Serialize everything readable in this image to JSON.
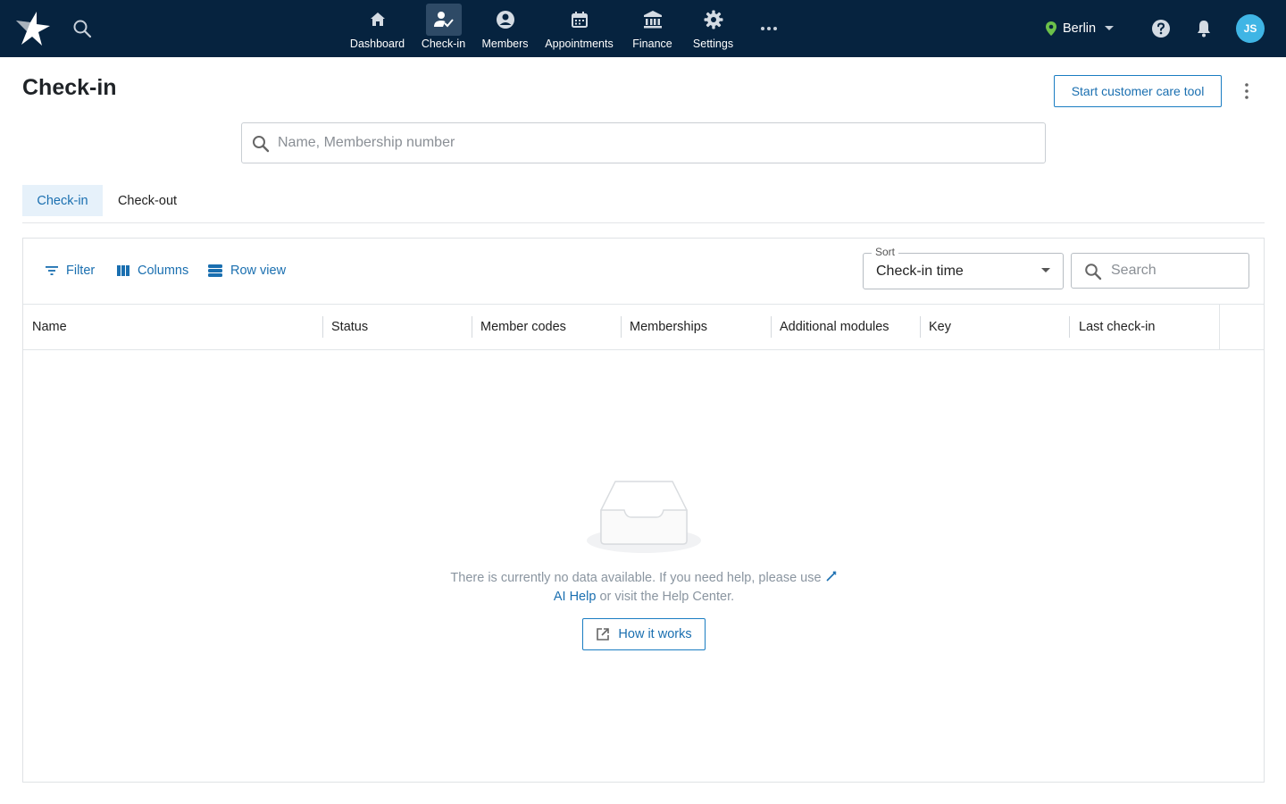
{
  "topbar": {
    "nav": [
      {
        "label": "Dashboard",
        "icon": "home-icon"
      },
      {
        "label": "Check-in",
        "icon": "check-in-icon",
        "active": true
      },
      {
        "label": "Members",
        "icon": "member-icon"
      },
      {
        "label": "Appointments",
        "icon": "calendar-icon"
      },
      {
        "label": "Finance",
        "icon": "bank-icon"
      },
      {
        "label": "Settings",
        "icon": "gear-icon"
      }
    ],
    "location": "Berlin",
    "avatar_initials": "JS"
  },
  "page": {
    "title": "Check-in",
    "customer_care_button": "Start customer care tool",
    "search_placeholder": "Name, Membership number"
  },
  "tabs": [
    "Check-in",
    "Check-out"
  ],
  "toolbar": {
    "filter": "Filter",
    "columns": "Columns",
    "row_view": "Row view",
    "sort_label": "Sort",
    "sort_value": "Check-in time",
    "search_placeholder": "Search"
  },
  "table": {
    "columns": [
      "Name",
      "Status",
      "Member codes",
      "Memberships",
      "Additional modules",
      "Key",
      "Last check-in"
    ]
  },
  "empty_state": {
    "text_before": "There is currently no data available. If you need help, please use",
    "ai_help": "AI Help",
    "text_after": "or visit the Help Center.",
    "how_button": "How it works"
  },
  "colors": {
    "topbar_bg": "#06233f",
    "accent": "#1a6fb0",
    "avatar_bg": "#3fb5e5",
    "location_pin": "#6cc04a"
  }
}
